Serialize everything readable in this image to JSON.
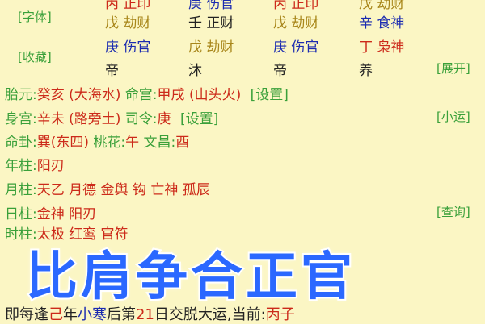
{
  "left_buttons": {
    "font": "[字体]",
    "collect": "[收藏]"
  },
  "right_buttons": {
    "expand": "[展开]",
    "luck": "[小运]",
    "query": "[查询]"
  },
  "grid": {
    "top_partial": [
      "丙 正印",
      "庚 伤官",
      "丙 正印",
      "戊 劫财"
    ],
    "row1": [
      {
        "gan": "戊",
        "god": "劫财",
        "color": "#a8861a"
      },
      {
        "gan": "壬",
        "god": "正财",
        "color": "#222222"
      },
      {
        "gan": "戊",
        "god": "劫财",
        "color": "#a8861a"
      },
      {
        "gan": "辛",
        "god": "食神",
        "color": "#1b2bb0"
      }
    ],
    "row2": [
      {
        "gan": "庚",
        "god": "伤官",
        "color": "#1b2bb0"
      },
      {
        "gan": "戊",
        "god": "劫财",
        "color": "#a8861a"
      },
      {
        "gan": "庚",
        "god": "伤官",
        "color": "#1b2bb0"
      },
      {
        "gan": "丁",
        "god": "枭神",
        "color": "#cc2a1a"
      }
    ],
    "row3": [
      "帝",
      "沐",
      "帝",
      "养"
    ]
  },
  "info": {
    "taiyuan_label": "胎元:",
    "taiyuan_value": "癸亥 (大海水)",
    "minggong_label": "命宫:",
    "minggong_value": "甲戌 (山头火)",
    "set1": "[设置]",
    "shengong_label": "身宫:",
    "shengong_value": "辛未 (路旁土)",
    "siling_label": "司令:",
    "siling_value": "庚",
    "set2": "[设置]",
    "minggua_label": "命卦:",
    "minggua_value": "巽(东四)",
    "taohua_label": "桃花:",
    "taohua_value": "午",
    "wenchang_label": "文昌:",
    "wenchang_value": "酉",
    "nianzhu_label": "年柱:",
    "nianzhu_value": "阳刃",
    "yuezhu_label": "月柱:",
    "yuezhu_value": "天乙 月德 金舆 钩 亡神 孤辰",
    "rizhu_label": "日柱:",
    "rizhu_value": "金神 阳刃",
    "shizhu_label": "时柱:",
    "shizhu_value": "太极 红鸾 官符"
  },
  "bottom_line": {
    "prefix": "即每逢",
    "year_gan": "己",
    "year_word": "年",
    "term": "小寒",
    "after": "后第",
    "days": "21",
    "suffix": "日交脱大运,当前:",
    "current": "丙子"
  },
  "overlay_title": "比肩争合正官"
}
